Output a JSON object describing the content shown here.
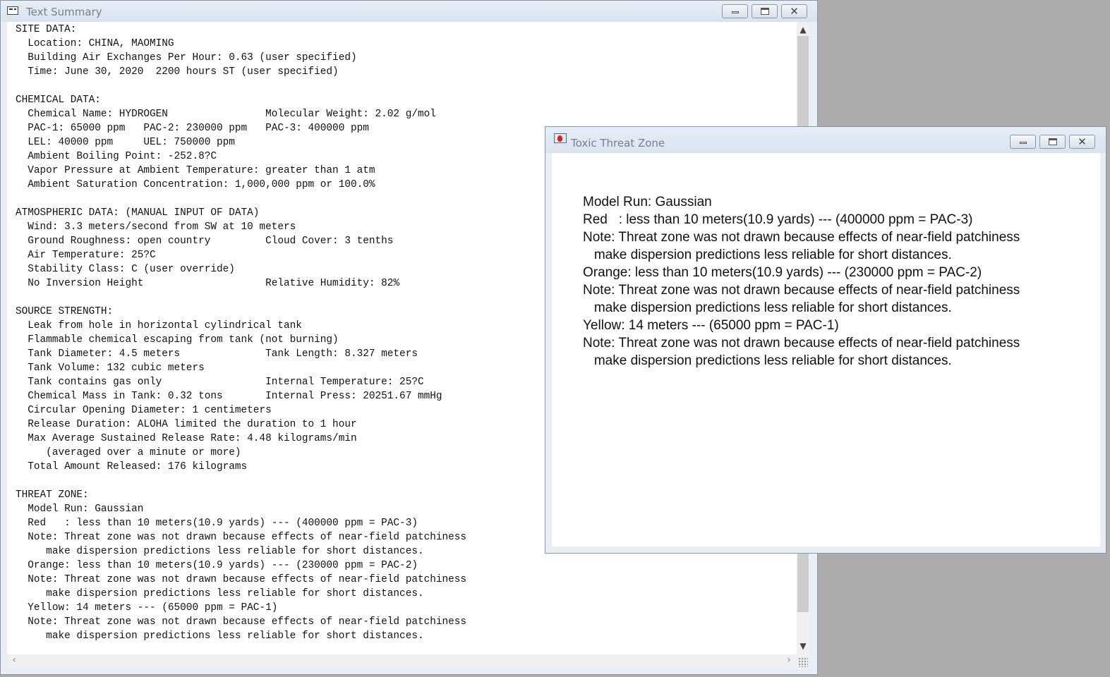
{
  "text_summary": {
    "title": "Text Summary",
    "lines": [
      "SITE DATA:",
      "  Location: CHINA, MAOMING",
      "  Building Air Exchanges Per Hour: 0.63 (user specified)",
      "  Time: June 30, 2020  2200 hours ST (user specified)",
      "",
      "CHEMICAL DATA:",
      "  Chemical Name: HYDROGEN                Molecular Weight: 2.02 g/mol",
      "  PAC-1: 65000 ppm   PAC-2: 230000 ppm   PAC-3: 400000 ppm",
      "  LEL: 40000 ppm     UEL: 750000 ppm",
      "  Ambient Boiling Point: -252.8?C",
      "  Vapor Pressure at Ambient Temperature: greater than 1 atm",
      "  Ambient Saturation Concentration: 1,000,000 ppm or 100.0%",
      "",
      "ATMOSPHERIC DATA: (MANUAL INPUT OF DATA)",
      "  Wind: 3.3 meters/second from SW at 10 meters",
      "  Ground Roughness: open country         Cloud Cover: 3 tenths",
      "  Air Temperature: 25?C",
      "  Stability Class: C (user override)",
      "  No Inversion Height                    Relative Humidity: 82%",
      "",
      "SOURCE STRENGTH:",
      "  Leak from hole in horizontal cylindrical tank",
      "  Flammable chemical escaping from tank (not burning)",
      "  Tank Diameter: 4.5 meters              Tank Length: 8.327 meters",
      "  Tank Volume: 132 cubic meters",
      "  Tank contains gas only                 Internal Temperature: 25?C",
      "  Chemical Mass in Tank: 0.32 tons       Internal Press: 20251.67 mmHg",
      "  Circular Opening Diameter: 1 centimeters",
      "  Release Duration: ALOHA limited the duration to 1 hour",
      "  Max Average Sustained Release Rate: 4.48 kilograms/min",
      "     (averaged over a minute or more)",
      "  Total Amount Released: 176 kilograms",
      "",
      "THREAT ZONE:",
      "  Model Run: Gaussian",
      "  Red   : less than 10 meters(10.9 yards) --- (400000 ppm = PAC-3)",
      "  Note: Threat zone was not drawn because effects of near-field patchiness",
      "     make dispersion predictions less reliable for short distances.",
      "  Orange: less than 10 meters(10.9 yards) --- (230000 ppm = PAC-2)",
      "  Note: Threat zone was not drawn because effects of near-field patchiness",
      "     make dispersion predictions less reliable for short distances.",
      "  Yellow: 14 meters --- (65000 ppm = PAC-1)",
      "  Note: Threat zone was not drawn because effects of near-field patchiness",
      "     make dispersion predictions less reliable for short distances."
    ]
  },
  "toxic_threat_zone": {
    "title": "Toxic Threat Zone",
    "lines": [
      "Model Run: Gaussian",
      "Red   : less than 10 meters(10.9 yards) --- (400000 ppm = PAC-3)",
      "Note: Threat zone was not drawn because effects of near-field patchiness",
      "   make dispersion predictions less reliable for short distances.",
      "Orange: less than 10 meters(10.9 yards) --- (230000 ppm = PAC-2)",
      "Note: Threat zone was not drawn because effects of near-field patchiness",
      "   make dispersion predictions less reliable for short distances.",
      "Yellow: 14 meters --- (65000 ppm = PAC-1)",
      "Note: Threat zone was not drawn because effects of near-field patchiness",
      "   make dispersion predictions less reliable for short distances."
    ]
  },
  "window_controls": {
    "close_glyph": "✕",
    "scroll_up": "▲",
    "scroll_down": "▼",
    "scroll_left": "‹",
    "scroll_right": "›"
  },
  "icons": {
    "text_summary": "document-icon",
    "toxic_threat_zone": "threat-zone-icon"
  }
}
